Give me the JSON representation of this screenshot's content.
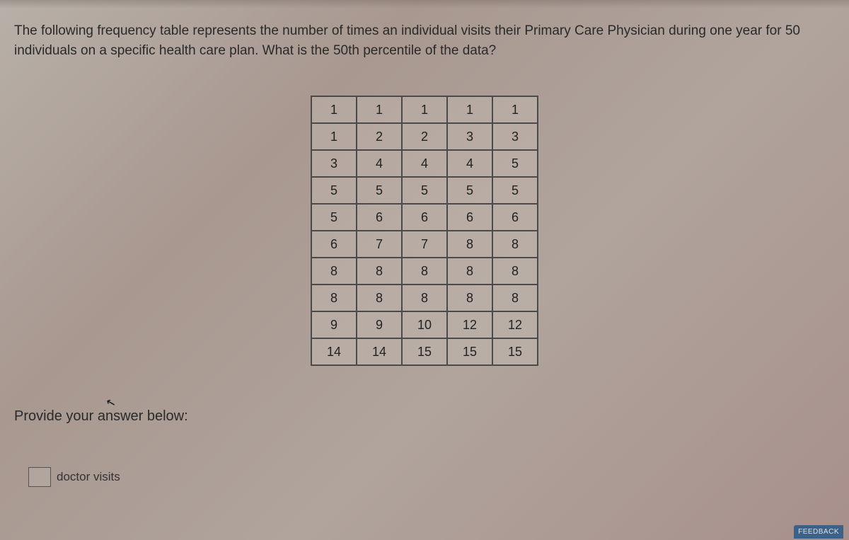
{
  "question": "The following frequency table represents the number of times an individual visits their Primary Care Physician during one year for 50 individuals on a specific health care plan. What is the 50th percentile of the data?",
  "table": [
    [
      "1",
      "1",
      "1",
      "1",
      "1"
    ],
    [
      "1",
      "2",
      "2",
      "3",
      "3"
    ],
    [
      "3",
      "4",
      "4",
      "4",
      "5"
    ],
    [
      "5",
      "5",
      "5",
      "5",
      "5"
    ],
    [
      "5",
      "6",
      "6",
      "6",
      "6"
    ],
    [
      "6",
      "7",
      "7",
      "8",
      "8"
    ],
    [
      "8",
      "8",
      "8",
      "8",
      "8"
    ],
    [
      "8",
      "8",
      "8",
      "8",
      "8"
    ],
    [
      "9",
      "9",
      "10",
      "12",
      "12"
    ],
    [
      "14",
      "14",
      "15",
      "15",
      "15"
    ]
  ],
  "answer_prompt": "Provide your answer below:",
  "input_label": "doctor visits",
  "feedback_label": "FEEDBACK"
}
